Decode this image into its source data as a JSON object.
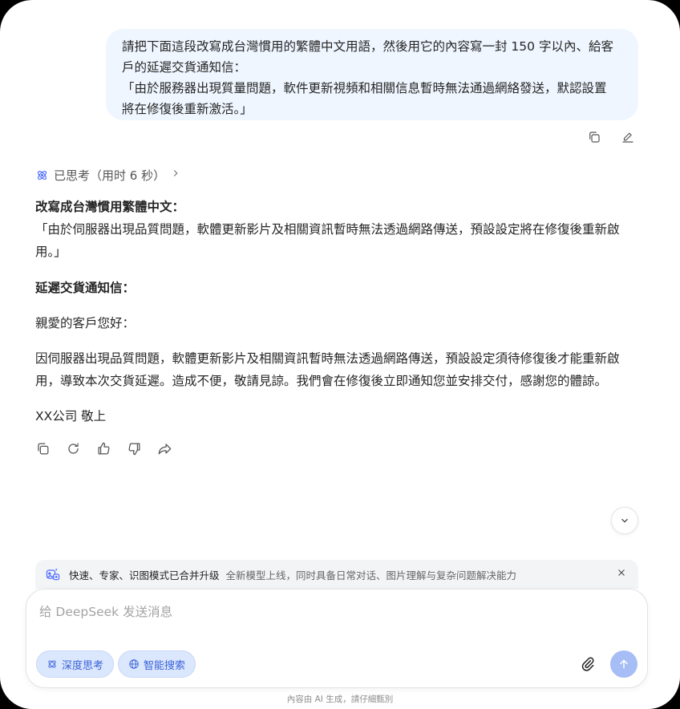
{
  "user_message": {
    "lines": [
      "請把下面這段改寫成台灣慣用的繁體中文用語，然後用它的內容寫一封 150 字以內、給客",
      "戶的延遲交貨通知信：",
      "「由於服務器出現質量問題，軟件更新視頻和相關信息暫時無法通過網絡發送，默認設置",
      "將在修復後重新激活。」"
    ]
  },
  "thought": {
    "label": "已思考（用时 6 秒）"
  },
  "answer": {
    "heading1": "改寫成台灣慣用繁體中文：",
    "rewrite_lines": [
      "「由於伺服器出現品質問題，軟體更新影片及相關資訊暫時無法透過網路傳送，預設設定將在修復後重新啟",
      "用。」"
    ],
    "heading2": "延遲交貨通知信：",
    "greeting": "親愛的客戶您好：",
    "body_lines": [
      "因伺服器出現品質問題，軟體更新影片及相關資訊暫時無法透過網路傳送，預設設定須待修復後才能重新啟",
      "用，導致本次交貨延遲。造成不便，敬請見諒。我們會在修復後立即通知您並安排交付，感謝您的體諒。"
    ],
    "signoff": "XX公司 敬上"
  },
  "banner": {
    "title": "快速、专家、识图模式已合并升级",
    "desc": "全新模型上线，同时具备日常对话、图片理解与复杂问题解决能力"
  },
  "composer": {
    "placeholder": "给 DeepSeek 发送消息",
    "value": "",
    "deep_think_label": "深度思考",
    "search_label": "智能搜索"
  },
  "footer": {
    "note": "內容由 AI 生成，請仔細甄別"
  },
  "colors": {
    "accent": "#4d6bfe",
    "bubble": "#eff6ff",
    "send_disabled": "#a6bdf6"
  }
}
